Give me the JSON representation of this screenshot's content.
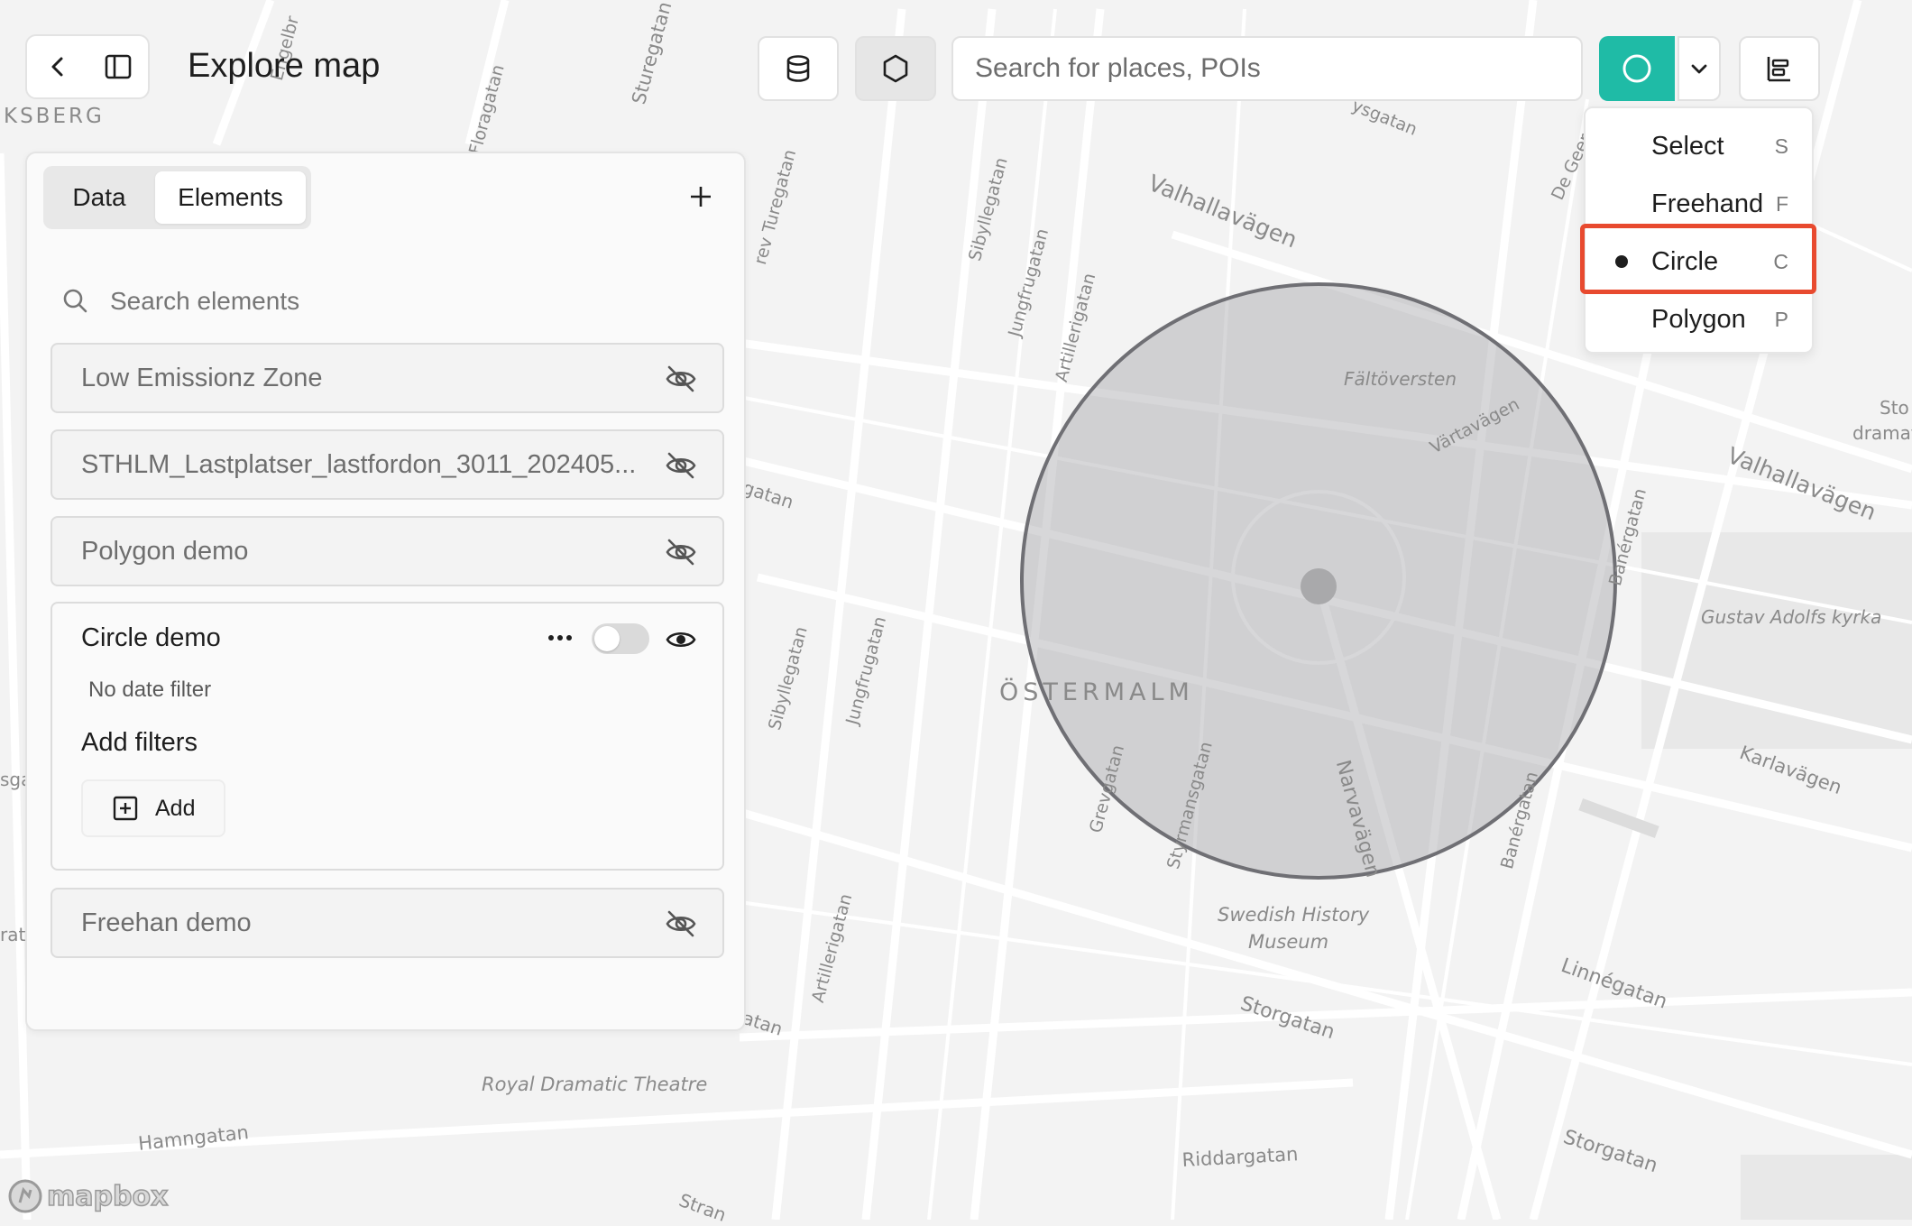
{
  "header": {
    "title": "Explore map"
  },
  "toolbar": {
    "search_placeholder": "Search for places, POIs",
    "accent_color": "#1fbba6",
    "icons": [
      "back-icon",
      "sidebar-icon",
      "database-icon",
      "hexagon-icon",
      "circle-icon",
      "chevron-down-icon",
      "layers-icon"
    ]
  },
  "draw_menu": {
    "items": [
      {
        "label": "Select",
        "key": "S",
        "selected": false
      },
      {
        "label": "Freehand",
        "key": "F",
        "selected": false
      },
      {
        "label": "Circle",
        "key": "C",
        "selected": true
      },
      {
        "label": "Polygon",
        "key": "P",
        "selected": false
      }
    ],
    "highlight_color": "#e84a2f"
  },
  "panel": {
    "tabs": [
      {
        "label": "Data",
        "active": false
      },
      {
        "label": "Elements",
        "active": true
      }
    ],
    "search_placeholder": "Search elements",
    "elements": [
      {
        "name": "Low Emissionz Zone",
        "visible": false
      },
      {
        "name": "STHLM_Lastplatser_lastfordon_3011_202405...",
        "visible": false
      },
      {
        "name": "Polygon demo",
        "visible": false
      },
      {
        "name": "Freehan demo",
        "visible": false
      }
    ],
    "active_element": {
      "name": "Circle demo",
      "date_filter": "No date filter",
      "filters_heading": "Add filters",
      "add_label": "Add",
      "visible": true
    }
  },
  "map": {
    "labels": {
      "ksberg": "KSBERG",
      "ostermalm": "ÖSTERMALM",
      "faltoversten": "Fältöversten",
      "vartavagen": "Värtavägen",
      "valhallavagen_1": "Valhallavägen",
      "valhallavagen_2": "Valhallavägen",
      "gustav": "Gustav Adolfs kyrka",
      "karlavagen": "Karlavägen",
      "swedish_history_1": "Swedish History",
      "swedish_history_2": "Museum",
      "storgatan_1": "Storgatan",
      "storgatan_2": "Storgatan",
      "linnegatan": "Linnégatan",
      "royal_dramatic": "Royal Dramatic Theatre",
      "riddargatan": "Riddargatan",
      "hamngatan": "Hamngatan",
      "narvavagen": "Narvavägen",
      "banergatan_1": "Banérgatan",
      "banergatan_2": "Banérgatan",
      "sibyllegatan_1": "Sibyllegatan",
      "sibyllegatan_2": "Sibyllegatan",
      "jungfrugatan_1": "Jungfrugatan",
      "jungfrugatan_2": "Jungfrugatan",
      "artillerigatan_1": "Artillerigatan",
      "artillerigatan_2": "Artillerigatan",
      "grevgatan": "Grevgatan",
      "styrmansgatan": "Styrmansgatan",
      "floragatan": "Floragatan",
      "sturegatan": "Sturegatan",
      "turegatan": "rev Turegatan",
      "engelbr": "Engelbr",
      "gatan_1": "gatan",
      "gatan_2": "atan",
      "ysgatan": "ysgatan",
      "de_geersg": "De Geersg",
      "sto_drama_1": "Sto",
      "sto_drama_2": "dramat",
      "strand": "Stran",
      "sga": "sga",
      "rat": "rat"
    },
    "attribution": "mapbox"
  }
}
